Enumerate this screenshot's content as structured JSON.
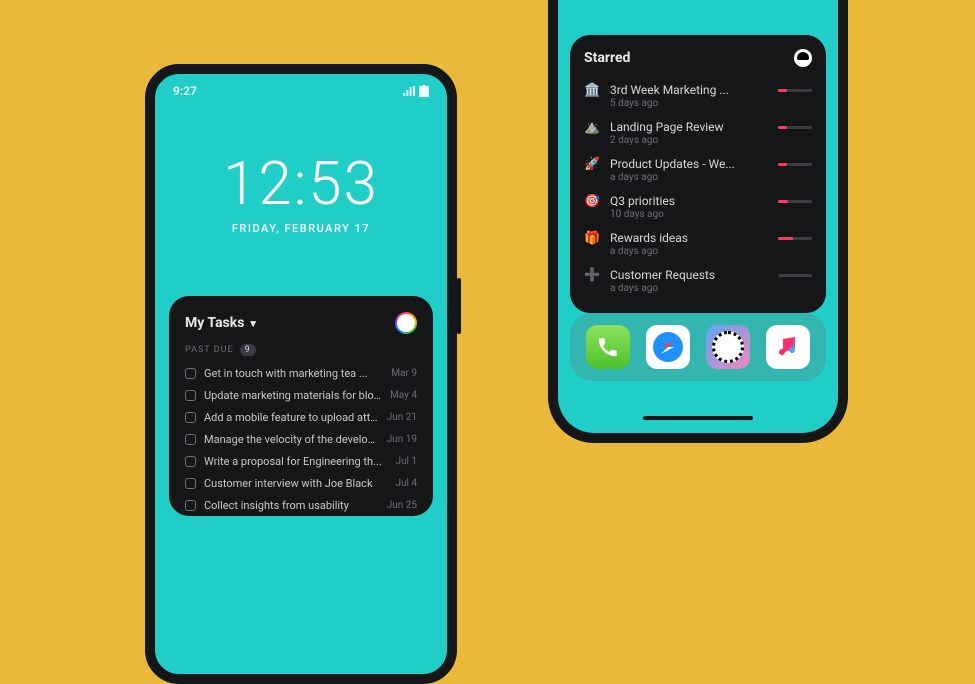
{
  "colors": {
    "page_bg": "#eab939",
    "phone_bg": "#21cdc7",
    "widget_bg": "#151618",
    "frame": "#141617",
    "meter_fill": "#ff3860"
  },
  "phone_a": {
    "status_time": "9:27",
    "clock_time": "12:53",
    "clock_date": "FRIDAY, FEBRUARY 17",
    "widget": {
      "title": "My Tasks",
      "section_label": "PAST DUE",
      "badge": "9",
      "tasks": [
        {
          "text": "Get in touch with marketing tea ...",
          "date": "Mar 9"
        },
        {
          "text": "Update marketing materials for blo...",
          "date": "May 4"
        },
        {
          "text": "Add a mobile feature to upload atta...",
          "date": "Jun 21"
        },
        {
          "text": "Manage the velocity of the develop...",
          "date": "Jun 19"
        },
        {
          "text": "Write a proposal for Engineering th...",
          "date": "Jul 1"
        },
        {
          "text": "Customer interview with Joe Black",
          "date": "Jul 4"
        },
        {
          "text": "Collect insights from usability",
          "date": "Jun 25"
        }
      ]
    }
  },
  "phone_b": {
    "widget": {
      "title": "Starred",
      "items": [
        {
          "icon": "🏛️",
          "title": "3rd Week Marketing ...",
          "subtitle": "5 days ago",
          "progress": 25
        },
        {
          "icon": "⛰️",
          "title": "Landing Page Review",
          "subtitle": "2 days ago",
          "progress": 25
        },
        {
          "icon": "🚀",
          "title": "Product Updates - We...",
          "subtitle": "a days ago",
          "progress": 25
        },
        {
          "icon": "🎯",
          "title": "Q3 priorities",
          "subtitle": "10 days ago",
          "progress": 30
        },
        {
          "icon": "🎁",
          "title": "Rewards ideas",
          "subtitle": "a days ago",
          "progress": 45
        },
        {
          "icon": "➕",
          "title": "Customer Requests",
          "subtitle": "a days ago",
          "progress": 0
        }
      ]
    },
    "dock_apps": [
      {
        "name": "phone"
      },
      {
        "name": "safari"
      },
      {
        "name": "pixel-app"
      },
      {
        "name": "music"
      }
    ]
  }
}
